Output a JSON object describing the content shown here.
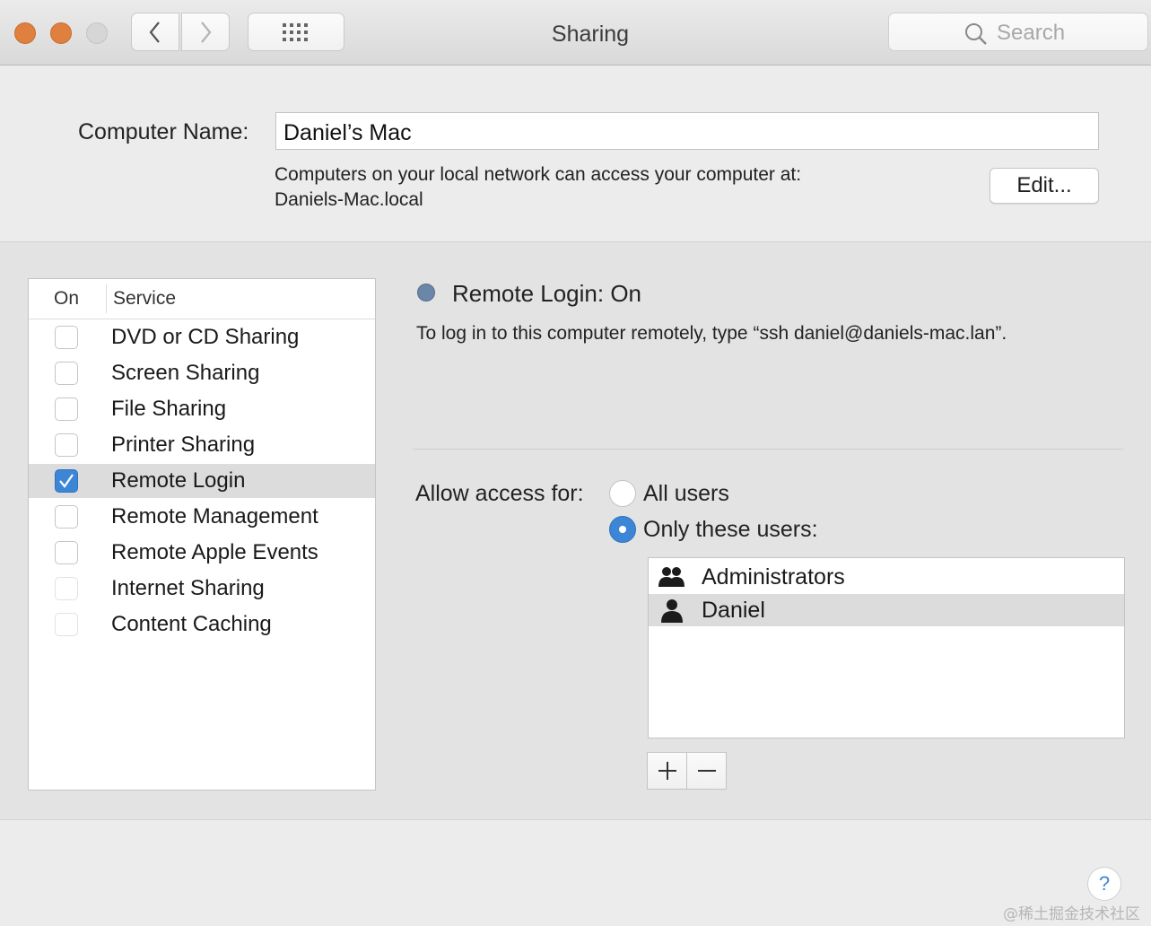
{
  "window": {
    "title": "Sharing",
    "search_placeholder": "Search"
  },
  "computer_name": {
    "label": "Computer Name:",
    "value": "Daniel’s Mac",
    "info_line1": "Computers on your local network can access your computer at:",
    "info_line2": "Daniels-Mac.local",
    "edit_label": "Edit..."
  },
  "services": {
    "header_on": "On",
    "header_service": "Service",
    "items": [
      {
        "label": "DVD or CD Sharing",
        "checked": false
      },
      {
        "label": "Screen Sharing",
        "checked": false
      },
      {
        "label": "File Sharing",
        "checked": false
      },
      {
        "label": "Printer Sharing",
        "checked": false
      },
      {
        "label": "Remote Login",
        "checked": true,
        "selected": true
      },
      {
        "label": "Remote Management",
        "checked": false
      },
      {
        "label": "Remote Apple Events",
        "checked": false
      },
      {
        "label": "Internet Sharing",
        "checked": false,
        "disabled": true
      },
      {
        "label": "Content Caching",
        "checked": false,
        "disabled": true
      }
    ]
  },
  "detail": {
    "status_title": "Remote Login: On",
    "status_color": "#6b86a6",
    "description": "To log in to this computer remotely, type “ssh daniel@daniels-mac.lan”.",
    "access_label": "Allow access for:",
    "option_all": "All users",
    "option_only": "Only these users:",
    "selected_option": "only",
    "users": [
      {
        "name": "Administrators",
        "icon": "group-icon"
      },
      {
        "name": "Daniel",
        "icon": "user-icon",
        "selected": true
      }
    ]
  },
  "help": {
    "label": "?"
  },
  "watermark": "@稀土掘金技术社区",
  "colors": {
    "accent": "#3d86d6",
    "traffic_light": "#e0803e"
  }
}
